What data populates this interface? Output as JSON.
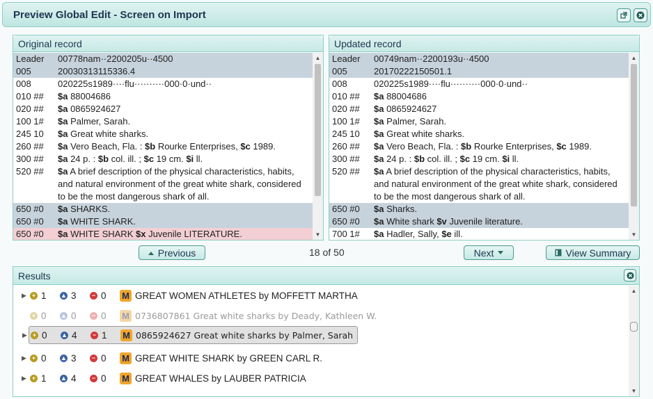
{
  "window": {
    "title": "Preview Global Edit - Screen on Import"
  },
  "original": {
    "heading": "Original record",
    "rows": [
      {
        "tag": "Leader",
        "text": "00778nam··2200205u··4500"
      },
      {
        "tag": "005",
        "text": "20030313115336.4"
      },
      {
        "tag": "008",
        "text": "020225s1989····flu··········000·0·und··"
      },
      {
        "tag": "010 ##",
        "sf": "$a",
        "text": "   88004686"
      },
      {
        "tag": "020 ##",
        "sf": "$a",
        "text": " 0865924627"
      },
      {
        "tag": "100 1#",
        "sf": "$a",
        "text": " Palmer, Sarah."
      },
      {
        "tag": "245 10",
        "sf": "$a",
        "text": " Great white sharks."
      },
      {
        "tag": "260 ##",
        "sf": "$a",
        "text": " Vero Beach, Fla. : ",
        "sf2": "$b",
        "text2": " Rourke Enterprises, ",
        "sf3": "$c",
        "text3": " 1989."
      },
      {
        "tag": "300 ##",
        "sf": "$a",
        "text": " 24 p. : ",
        "sf2": "$b",
        "text2": " col. ill. ; ",
        "sf3": "$c",
        "text3": " 19 cm. ",
        "sf4": "$i",
        "text4": " ll."
      },
      {
        "tag": "520 ##",
        "sf": "$a",
        "text": " A brief description of the physical characteristics, habits, and natural environment of the great white shark, considered to be the most dangerous shark of all."
      },
      {
        "tag": "650 #0",
        "sf": "$a",
        "text": " SHARKS."
      },
      {
        "tag": "650 #0",
        "sf": "$a",
        "text": " WHITE SHARK."
      },
      {
        "tag": "650 #0",
        "sf": "$a",
        "text": " WHITE SHARK ",
        "sf2": "$x",
        "text2": " Juvenile LITERATURE."
      }
    ]
  },
  "updated": {
    "heading": "Updated record",
    "rows": [
      {
        "tag": "Leader",
        "text": "00749nam··2200193u··4500"
      },
      {
        "tag": "005",
        "text": "20170222150501.1"
      },
      {
        "tag": "008",
        "text": "020225s1989····flu··········000·0·und··"
      },
      {
        "tag": "010 ##",
        "sf": "$a",
        "text": "   88004686"
      },
      {
        "tag": "020 ##",
        "sf": "$a",
        "text": " 0865924627"
      },
      {
        "tag": "100 1#",
        "sf": "$a",
        "text": " Palmer, Sarah."
      },
      {
        "tag": "245 10",
        "sf": "$a",
        "text": " Great white sharks."
      },
      {
        "tag": "260 ##",
        "sf": "$a",
        "text": " Vero Beach, Fla. : ",
        "sf2": "$b",
        "text2": " Rourke Enterprises, ",
        "sf3": "$c",
        "text3": " 1989."
      },
      {
        "tag": "300 ##",
        "sf": "$a",
        "text": " 24 p. : ",
        "sf2": "$b",
        "text2": " col. ill. ; ",
        "sf3": "$c",
        "text3": " 19 cm. ",
        "sf4": "$i",
        "text4": " ll."
      },
      {
        "tag": "520 ##",
        "sf": "$a",
        "text": " A brief description of the physical characteristics, habits, and natural environment of the great white shark, considered to be the most dangerous shark of all."
      },
      {
        "tag": "650 #0",
        "sf": "$a",
        "text": " Sharks."
      },
      {
        "tag": "650 #0",
        "sf": "$a",
        "text": " White shark ",
        "sf2": "$v",
        "text2": " Juvenile literature."
      },
      {
        "tag": "700 1#",
        "sf": "$a",
        "text": " Hadler, Sally, ",
        "sf2": "$e",
        "text2": " ill."
      }
    ]
  },
  "nav": {
    "previous_label": "Previous",
    "counter": "18 of 50",
    "next_label": "Next",
    "summary_label": "View Summary"
  },
  "results": {
    "heading": "Results",
    "items": [
      {
        "add": "1",
        "mod": "3",
        "rem": "0",
        "text": "GREAT WOMEN ATHLETES by MOFFETT MARTHA",
        "state": "normal"
      },
      {
        "add": "0",
        "mod": "0",
        "rem": "0",
        "text": "0736807861 Great white sharks by Deady, Kathleen W.",
        "state": "dim"
      },
      {
        "add": "0",
        "mod": "4",
        "rem": "1",
        "text": "0865924627 Great white sharks by Palmer, Sarah",
        "state": "selected"
      },
      {
        "add": "0",
        "mod": "3",
        "rem": "0",
        "text": "GREAT WHITE SHARK by GREEN CARL R.",
        "state": "normal"
      },
      {
        "add": "1",
        "mod": "4",
        "rem": "0",
        "text": "GREAT WHALES by LAUBER PATRICIA",
        "state": "normal"
      }
    ]
  },
  "icons": {
    "add": "plus-circle-icon",
    "modify": "triangle-circle-icon",
    "remove": "minus-circle-icon",
    "material": "book-m-icon"
  }
}
